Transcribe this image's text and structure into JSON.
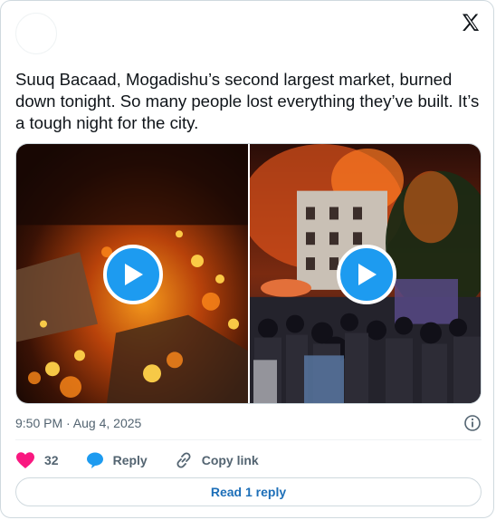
{
  "tweet": {
    "text": "Suuq Bacaad, Mogadishu’s second largest market, burned down tonight. So many people lost everything they’ve built. It’s a tough night for the city.",
    "timestamp": "9:50 PM · Aug 4, 2025"
  },
  "media": {
    "videos": [
      {
        "description_icon": "play-icon"
      },
      {
        "description_icon": "play-icon"
      }
    ]
  },
  "actions": {
    "like_count": "32",
    "reply_label": "Reply",
    "copy_link_label": "Copy link"
  },
  "read_replies": {
    "label": "Read 1 reply"
  },
  "colors": {
    "accent": "#1d9bf0",
    "like": "#f91880",
    "text": "#0f1419",
    "muted": "#536471",
    "border": "#cfd9de"
  },
  "icons": {
    "brand": "x-logo-icon",
    "info": "info-icon",
    "like": "heart-icon",
    "reply": "speech-bubble-icon",
    "copy_link": "link-icon"
  }
}
